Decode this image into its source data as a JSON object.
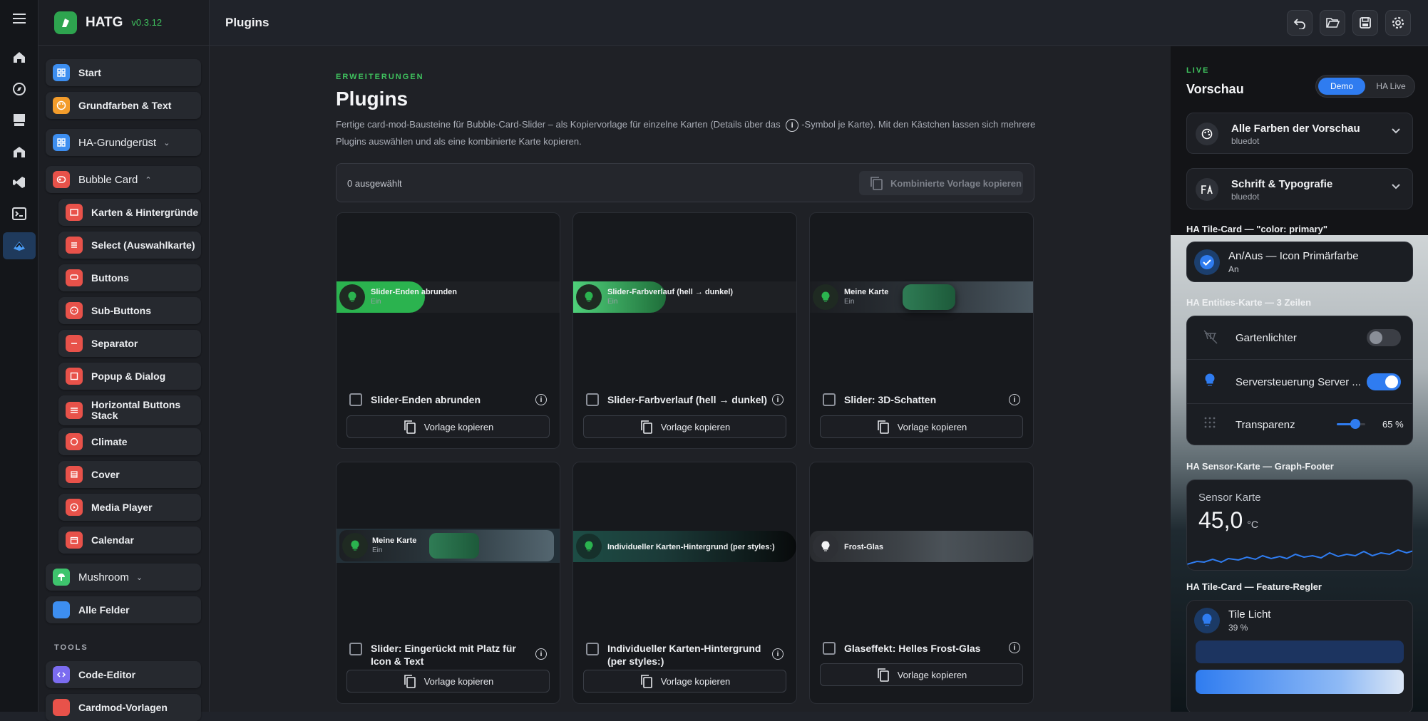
{
  "app": {
    "name": "HATG",
    "version": "v0.3.12"
  },
  "header": {
    "title": "Plugins"
  },
  "sidebar": {
    "items": [
      {
        "label": "Start"
      },
      {
        "label": "Grundfarben & Text"
      },
      {
        "label": "HA-Grundgerüst"
      },
      {
        "label": "Bubble Card"
      },
      {
        "label": "Karten & Hintergründe"
      },
      {
        "label": "Select (Auswahlkarte)"
      },
      {
        "label": "Buttons"
      },
      {
        "label": "Sub-Buttons"
      },
      {
        "label": "Separator"
      },
      {
        "label": "Popup & Dialog"
      },
      {
        "label": "Horizontal Buttons Stack"
      },
      {
        "label": "Climate"
      },
      {
        "label": "Cover"
      },
      {
        "label": "Media Player"
      },
      {
        "label": "Calendar"
      },
      {
        "label": "Mushroom"
      },
      {
        "label": "Alle Felder"
      }
    ],
    "tools_header": "TOOLS",
    "tools": [
      {
        "label": "Code-Editor"
      },
      {
        "label": "Cardmod-Vorlagen"
      }
    ]
  },
  "main": {
    "eyebrow": "ERWEITERUNGEN",
    "title": "Plugins",
    "desc_part1": "Fertige card-mod-Bausteine für Bubble-Card-Slider – als Kopiervorlage für einzelne Karten (Details über das ",
    "desc_part2": "-Symbol je Karte). Mit den Kästchen lassen sich mehrere Plugins auswählen und als eine kombinierte Karte kopieren.",
    "selected_count": "0 ausgewählt",
    "combined_button": "Kombinierte Vorlage kopieren",
    "copy_label": "Vorlage kopieren",
    "cards": [
      {
        "title": "Slider-Enden abrunden",
        "preview_name": "Slider-Enden abrunden",
        "preview_state": "Ein"
      },
      {
        "title": "Slider-Farbverlauf (hell → dunkel)",
        "preview_name": "Slider-Farbverlauf (hell → dunkel)",
        "preview_state": "Ein"
      },
      {
        "title": "Slider: 3D-Schatten",
        "preview_name": "Meine Karte",
        "preview_state": "Ein"
      },
      {
        "title": "Slider: Eingerückt mit Platz für Icon & Text",
        "preview_name": "Meine Karte",
        "preview_state": "Ein"
      },
      {
        "title": "Individueller Karten-Hintergrund (per styles:)",
        "preview_name": "Individueller Karten-Hintergrund (per styles:)",
        "preview_state": ""
      },
      {
        "title": "Glaseffekt: Helles Frost-Glas",
        "preview_name": "Frost-Glas",
        "preview_state": ""
      }
    ]
  },
  "preview_panel": {
    "live": "LIVE",
    "title": "Vorschau",
    "seg_demo": "Demo",
    "seg_live": "HA Live",
    "acc1": {
      "title": "Alle Farben der Vorschau",
      "sub": "bluedot"
    },
    "acc2": {
      "title": "Schrift & Typografie",
      "sub": "bluedot"
    },
    "tile_section": "HA Tile-Card — \"color: primary\"",
    "tile": {
      "name": "An/Aus — Icon Primärfarbe",
      "state": "An"
    },
    "entities_section": "HA Entities-Karte — 3 Zeilen",
    "entities": [
      {
        "name": "Gartenlichter"
      },
      {
        "name": "Serversteuerung Server ..."
      },
      {
        "name": "Transparenz",
        "value": "65 %",
        "level": 0.65
      }
    ],
    "sensor_section": "HA Sensor-Karte — Graph-Footer",
    "sensor": {
      "name": "Sensor Karte",
      "value": "45,0",
      "unit": "°C"
    },
    "feature_section": "HA Tile-Card — Feature-Regler",
    "feature": {
      "name": "Tile Licht",
      "state": "39 %",
      "level": 0.39
    }
  },
  "colors": {
    "accent_green": "#3fc25e",
    "accent_blue": "#2f7cf0"
  }
}
